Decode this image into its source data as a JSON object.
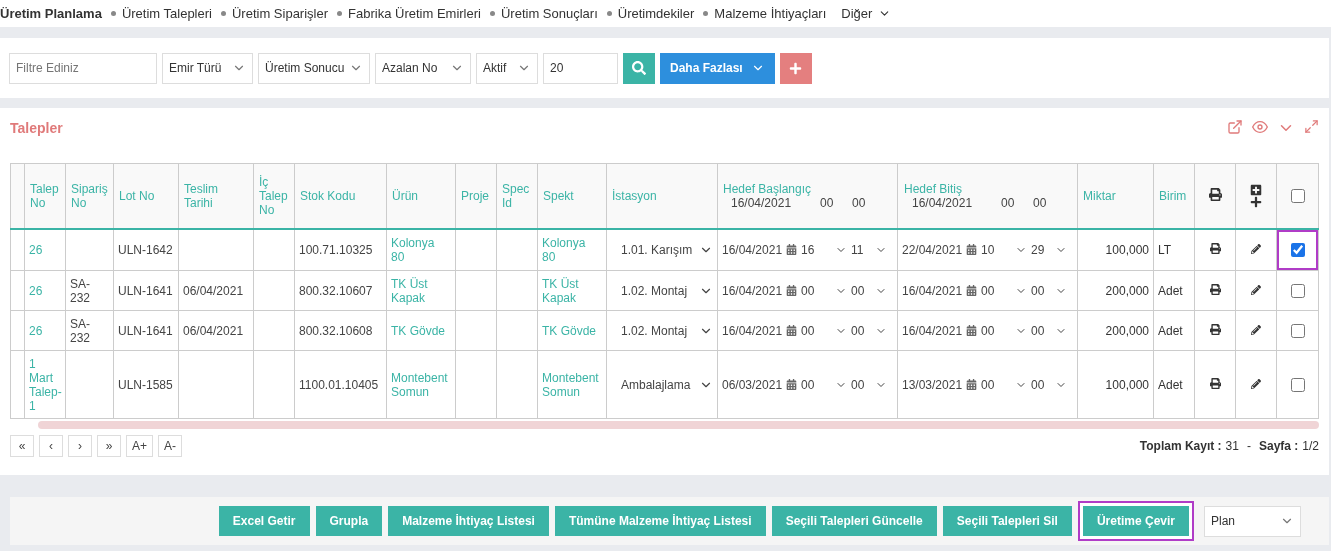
{
  "nav": [
    {
      "label": "Üretim Planlama",
      "selected": true
    },
    {
      "label": "Üretim Talepleri",
      "selected": false
    },
    {
      "label": "Üretim Siparişler",
      "selected": false
    },
    {
      "label": "Fabrika Üretim Emirleri",
      "selected": false
    },
    {
      "label": "Üretim Sonuçları",
      "selected": false
    },
    {
      "label": "Üretimdekiler",
      "selected": false
    },
    {
      "label": "Malzeme İhtiyaçları",
      "selected": false
    }
  ],
  "nav_more": "Diğer",
  "filters": {
    "search_placeholder": "Filtre Ediniz",
    "selects": [
      "Emir Türü",
      "Üretim Sonucu",
      "Azalan No",
      "Aktif"
    ],
    "count": "20",
    "more_button": "Daha Fazlası"
  },
  "panel": {
    "title": "Talepler"
  },
  "table": {
    "columns": [
      "Talep No",
      "Sipariş No",
      "Lot No",
      "Teslim Tarihi",
      "İç Talep No",
      "Stok Kodu",
      "Ürün",
      "Proje",
      "Spec Id",
      "Spekt",
      "İstasyon",
      "Hedef Başlangıç",
      "Hedef Bitiş",
      "Miktar",
      "Birim"
    ],
    "start_filter": {
      "date": "16/04/2021",
      "hour": "00",
      "minute": "00"
    },
    "end_filter": {
      "date": "16/04/2021",
      "hour": "00",
      "minute": "00"
    },
    "all_checked": false,
    "rows": [
      {
        "talep_no": "26",
        "siparis_no": "",
        "lot_no": "ULN-1642",
        "teslim": "",
        "ic_talep": "",
        "stok_kodu": "100.71.10325",
        "urun": "Kolonya 80",
        "proje": "",
        "spec_id": "",
        "spekt": "Kolonya 80",
        "istasyon": "1.01. Karışım",
        "start": {
          "date": "16/04/2021",
          "hour": "16",
          "minute": "11"
        },
        "end": {
          "date": "22/04/2021",
          "hour": "10",
          "minute": "29"
        },
        "miktar": "100,000",
        "birim": "LT",
        "checked": true,
        "highlighted": true
      },
      {
        "talep_no": "26",
        "siparis_no": "SA-232",
        "lot_no": "ULN-1641",
        "teslim": "06/04/2021",
        "ic_talep": "",
        "stok_kodu": "800.32.10607",
        "urun": "TK Üst Kapak",
        "proje": "",
        "spec_id": "",
        "spekt": "TK Üst Kapak",
        "istasyon": "1.02. Montaj",
        "start": {
          "date": "16/04/2021",
          "hour": "00",
          "minute": "00"
        },
        "end": {
          "date": "16/04/2021",
          "hour": "00",
          "minute": "00"
        },
        "miktar": "200,000",
        "birim": "Adet",
        "checked": false,
        "highlighted": false
      },
      {
        "talep_no": "26",
        "siparis_no": "SA-232",
        "lot_no": "ULN-1641",
        "teslim": "06/04/2021",
        "ic_talep": "",
        "stok_kodu": "800.32.10608",
        "urun": "TK Gövde",
        "proje": "",
        "spec_id": "",
        "spekt": "TK Gövde",
        "istasyon": "1.02. Montaj",
        "start": {
          "date": "16/04/2021",
          "hour": "00",
          "minute": "00"
        },
        "end": {
          "date": "16/04/2021",
          "hour": "00",
          "minute": "00"
        },
        "miktar": "200,000",
        "birim": "Adet",
        "checked": false,
        "highlighted": false
      },
      {
        "talep_no": "1 Mart Talep-1",
        "siparis_no": "",
        "lot_no": "ULN-1585",
        "teslim": "",
        "ic_talep": "",
        "stok_kodu": "1100.01.10405",
        "urun": "Montebent Somun",
        "proje": "",
        "spec_id": "",
        "spekt": "Montebent Somun",
        "istasyon": "Ambalajlama",
        "start": {
          "date": "06/03/2021",
          "hour": "00",
          "minute": "00"
        },
        "end": {
          "date": "13/03/2021",
          "hour": "00",
          "minute": "00"
        },
        "miktar": "100,000",
        "birim": "Adet",
        "checked": false,
        "highlighted": false
      }
    ]
  },
  "pager": {
    "buttons": [
      "«",
      "‹",
      "›",
      "»",
      "A+",
      "A-"
    ],
    "total_label": "Toplam Kayıt :",
    "total": "31",
    "separator": "-",
    "page_label": "Sayfa :",
    "page": "1/2"
  },
  "actions": [
    {
      "label": "Excel Getir",
      "highlighted": false
    },
    {
      "label": "Grupla",
      "highlighted": false
    },
    {
      "label": "Malzeme İhtiyaç Listesi",
      "highlighted": false
    },
    {
      "label": "Tümüne Malzeme İhtiyaç Listesi",
      "highlighted": false
    },
    {
      "label": "Seçili Talepleri Güncelle",
      "highlighted": false
    },
    {
      "label": "Seçili Talepleri Sil",
      "highlighted": false
    },
    {
      "label": "Üretime Çevir",
      "highlighted": true
    }
  ],
  "plan_select": "Plan"
}
